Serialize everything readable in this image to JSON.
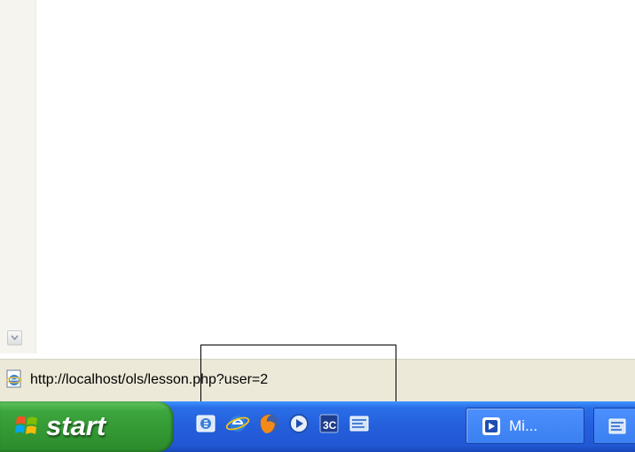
{
  "status_bar": {
    "url_text": "http://localhost/ols/lesson.php?user=2",
    "icon": "ie-page-icon"
  },
  "taskbar": {
    "start_label": "start",
    "quick_launch": [
      {
        "icon": "outlook-express-icon"
      },
      {
        "icon": "internet-explorer-icon"
      },
      {
        "icon": "firefox-icon"
      },
      {
        "icon": "media-player-icon"
      },
      {
        "icon": "app-3c-icon"
      },
      {
        "icon": "show-desktop-icon"
      }
    ],
    "tasks": [
      {
        "label": "Mi...",
        "icon": "app-window-icon"
      },
      {
        "label": "",
        "icon": "ie-window-icon"
      }
    ]
  },
  "colors": {
    "taskbar_blue": "#245edb",
    "start_green": "#339833",
    "status_bar_bg": "#ece9d8"
  }
}
